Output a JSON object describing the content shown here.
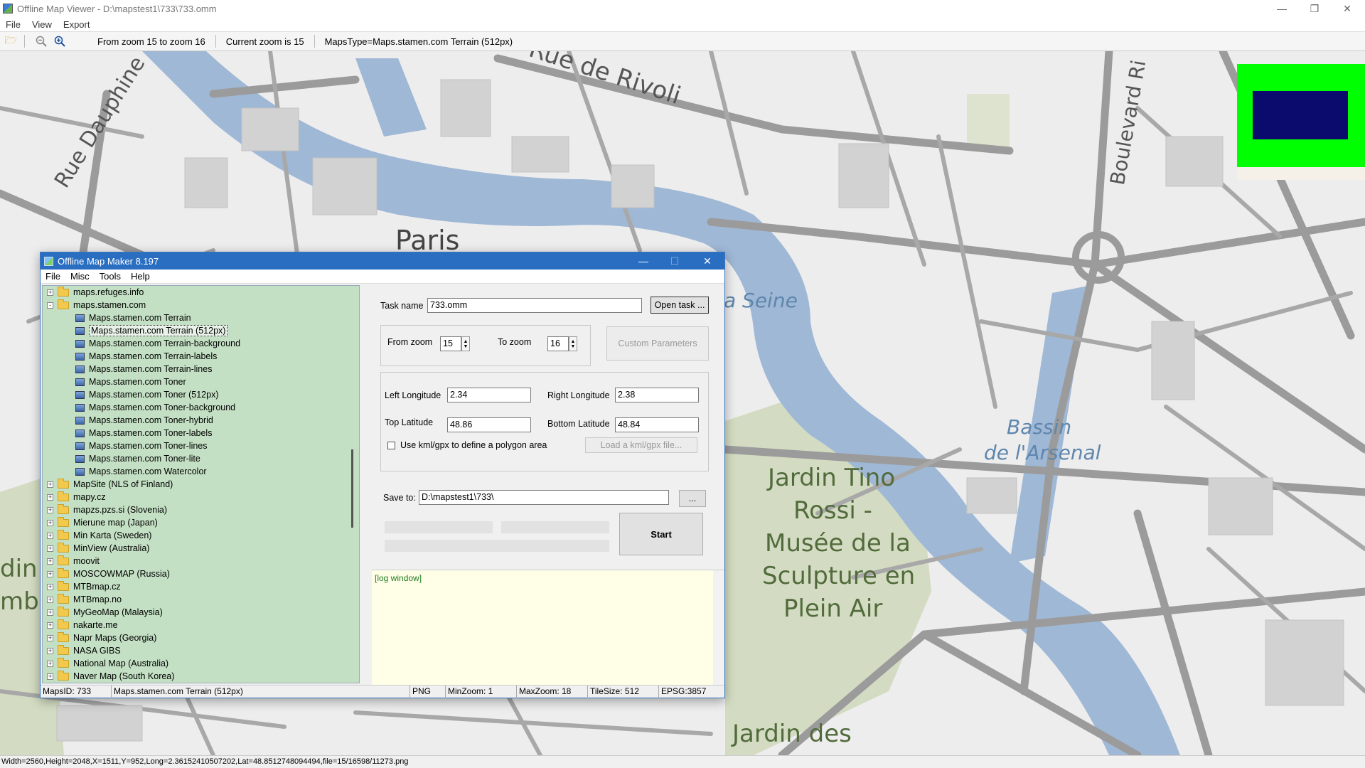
{
  "viewer": {
    "title": "Offline Map Viewer - D:\\mapstest1\\733\\733.omm",
    "menu": [
      "File",
      "View",
      "Export"
    ],
    "toolbar": {
      "zoom_range": "From zoom 15 to zoom 16",
      "current_zoom": "Current zoom is 15",
      "maps_type": "MapsType=Maps.stamen.com Terrain (512px)"
    },
    "status": "Width=2560,Height=2048,X=1511,Y=952,Long=2.36152410507202,Lat=48.8512748094494,file=15/16598/11273.png"
  },
  "map_labels": {
    "rue_de_rivoli": "Rue de Rivoli",
    "rue_dauphine": "Rue Dauphine",
    "paris": "Paris",
    "seine": "a Seine",
    "boulevard": "Boulevard Ri",
    "bassin_1": "Bassin",
    "bassin_2": "de l'Arsenal",
    "jardin_tino_1": "Jardin Tino",
    "jardin_tino_2": "Rossi -",
    "jardin_tino_3": "Musée de la",
    "jardin_tino_4": "Sculpture en",
    "jardin_tino_5": "Plein Air",
    "jardin_des": "Jardin des",
    "left_fragment_1": "din d",
    "left_fragment_2": "mbo"
  },
  "maker": {
    "title": "Offline Map Maker 8.197",
    "menu": [
      "File",
      "Misc",
      "Tools",
      "Help"
    ],
    "tree": [
      {
        "label": "maps.refuges.info",
        "type": "folder",
        "expander": "+"
      },
      {
        "label": "maps.stamen.com",
        "type": "folder-open",
        "expander": "-"
      },
      {
        "label": "Maps.stamen.com Terrain",
        "type": "map"
      },
      {
        "label": "Maps.stamen.com Terrain (512px)",
        "type": "map",
        "selected": true
      },
      {
        "label": "Maps.stamen.com Terrain-background",
        "type": "map"
      },
      {
        "label": "Maps.stamen.com Terrain-labels",
        "type": "map"
      },
      {
        "label": "Maps.stamen.com Terrain-lines",
        "type": "map"
      },
      {
        "label": "Maps.stamen.com Toner",
        "type": "map"
      },
      {
        "label": "Maps.stamen.com Toner (512px)",
        "type": "map"
      },
      {
        "label": "Maps.stamen.com Toner-background",
        "type": "map"
      },
      {
        "label": "Maps.stamen.com Toner-hybrid",
        "type": "map"
      },
      {
        "label": "Maps.stamen.com Toner-labels",
        "type": "map"
      },
      {
        "label": "Maps.stamen.com Toner-lines",
        "type": "map"
      },
      {
        "label": "Maps.stamen.com Toner-lite",
        "type": "map"
      },
      {
        "label": "Maps.stamen.com Watercolor",
        "type": "map"
      },
      {
        "label": "MapSite (NLS of Finland)",
        "type": "folder",
        "expander": "+"
      },
      {
        "label": "mapy.cz",
        "type": "folder",
        "expander": "+"
      },
      {
        "label": "mapzs.pzs.si (Slovenia)",
        "type": "folder",
        "expander": "+"
      },
      {
        "label": "Mierune map (Japan)",
        "type": "folder",
        "expander": "+"
      },
      {
        "label": "Min Karta (Sweden)",
        "type": "folder",
        "expander": "+"
      },
      {
        "label": "MinView (Australia)",
        "type": "folder",
        "expander": "+"
      },
      {
        "label": "moovit",
        "type": "folder",
        "expander": "+"
      },
      {
        "label": "MOSCOWMAP (Russia)",
        "type": "folder",
        "expander": "+"
      },
      {
        "label": "MTBmap.cz",
        "type": "folder",
        "expander": "+"
      },
      {
        "label": "MTBmap.no",
        "type": "folder",
        "expander": "+"
      },
      {
        "label": "MyGeoMap (Malaysia)",
        "type": "folder",
        "expander": "+"
      },
      {
        "label": "nakarte.me",
        "type": "folder",
        "expander": "+"
      },
      {
        "label": "Napr Maps (Georgia)",
        "type": "folder",
        "expander": "+"
      },
      {
        "label": "NASA GIBS",
        "type": "folder",
        "expander": "+"
      },
      {
        "label": "National Map (Australia)",
        "type": "folder",
        "expander": "+"
      },
      {
        "label": "Naver Map (South Korea)",
        "type": "folder",
        "expander": "+"
      }
    ],
    "form": {
      "task_name_label": "Task name",
      "task_name_value": "733.omm",
      "open_task_button": "Open task ...",
      "from_zoom_label": "From zoom",
      "from_zoom_value": "15",
      "to_zoom_label": "To zoom",
      "to_zoom_value": "16",
      "custom_params_button": "Custom Parameters",
      "left_lon_label": "Left Longitude",
      "left_lon_value": "2.34",
      "right_lon_label": "Right Longitude",
      "right_lon_value": "2.38",
      "top_lat_label": "Top Latitude",
      "top_lat_value": "48.86",
      "bottom_lat_label": "Bottom Latitude",
      "bottom_lat_value": "48.84",
      "kml_checkbox_label": "Use kml/gpx to define a polygon area",
      "load_kml_button": "Load a kml/gpx file...",
      "save_to_label": "Save to:",
      "save_to_value": "D:\\mapstest1\\733\\",
      "browse_button": "...",
      "start_button": "Start",
      "log_text": "[log window]"
    },
    "status": {
      "maps_id": "MapsID: 733",
      "map_name": "Maps.stamen.com Terrain (512px)",
      "format": "PNG",
      "min_zoom": "MinZoom: 1",
      "max_zoom": "MaxZoom: 18",
      "tile_size": "TileSize: 512",
      "epsg": "EPSG:3857"
    }
  },
  "colors": {
    "map_bg": "#ededed",
    "road": "#9b9b9b",
    "water": "#9fb8d6",
    "park": "#d3dcc2",
    "tree_bg": "#c4e0c4",
    "titlebar": "#2a6ec1"
  }
}
